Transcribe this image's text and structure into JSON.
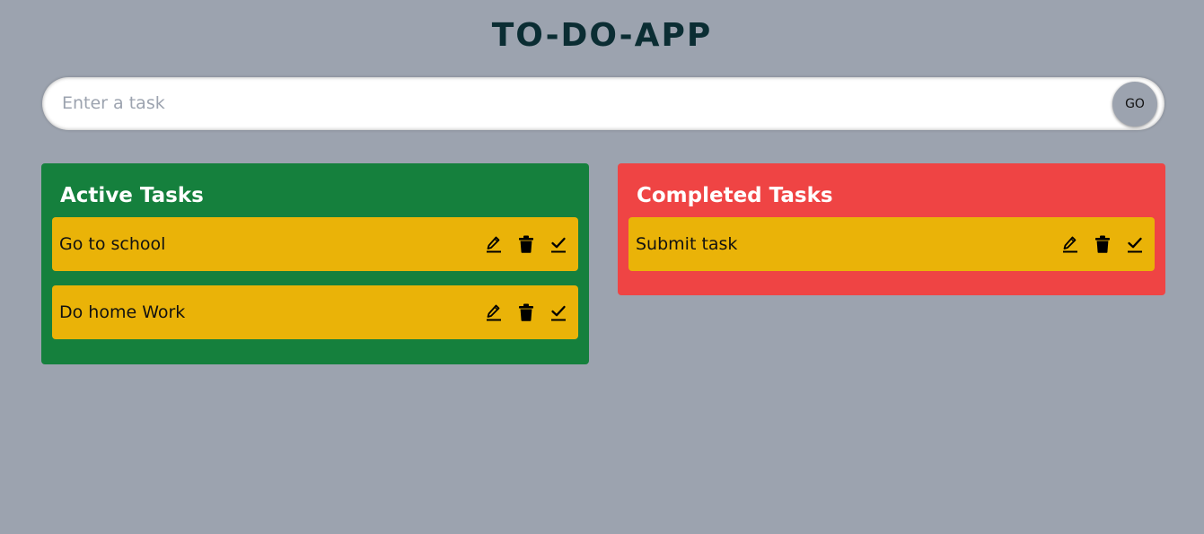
{
  "app": {
    "title": "TO-DO-APP"
  },
  "form": {
    "input_value": "",
    "placeholder": "Enter a task",
    "go_label": "GO"
  },
  "colors": {
    "background": "#9ca3af",
    "title": "#0b2d33",
    "active_panel": "#15803d",
    "completed_panel": "#ef4444",
    "task_card": "#eab308"
  },
  "active": {
    "title": "Active Tasks",
    "tasks": [
      {
        "text": "Go to school",
        "actions": [
          "pencil-icon",
          "trash-icon",
          "check-icon"
        ]
      },
      {
        "text": "Do home Work",
        "actions": [
          "pencil-icon",
          "trash-icon",
          "check-icon"
        ]
      }
    ]
  },
  "completed": {
    "title": "Completed Tasks",
    "tasks": [
      {
        "text": "Submit task",
        "actions": [
          "pencil-icon",
          "trash-icon",
          "check-icon"
        ]
      }
    ]
  }
}
